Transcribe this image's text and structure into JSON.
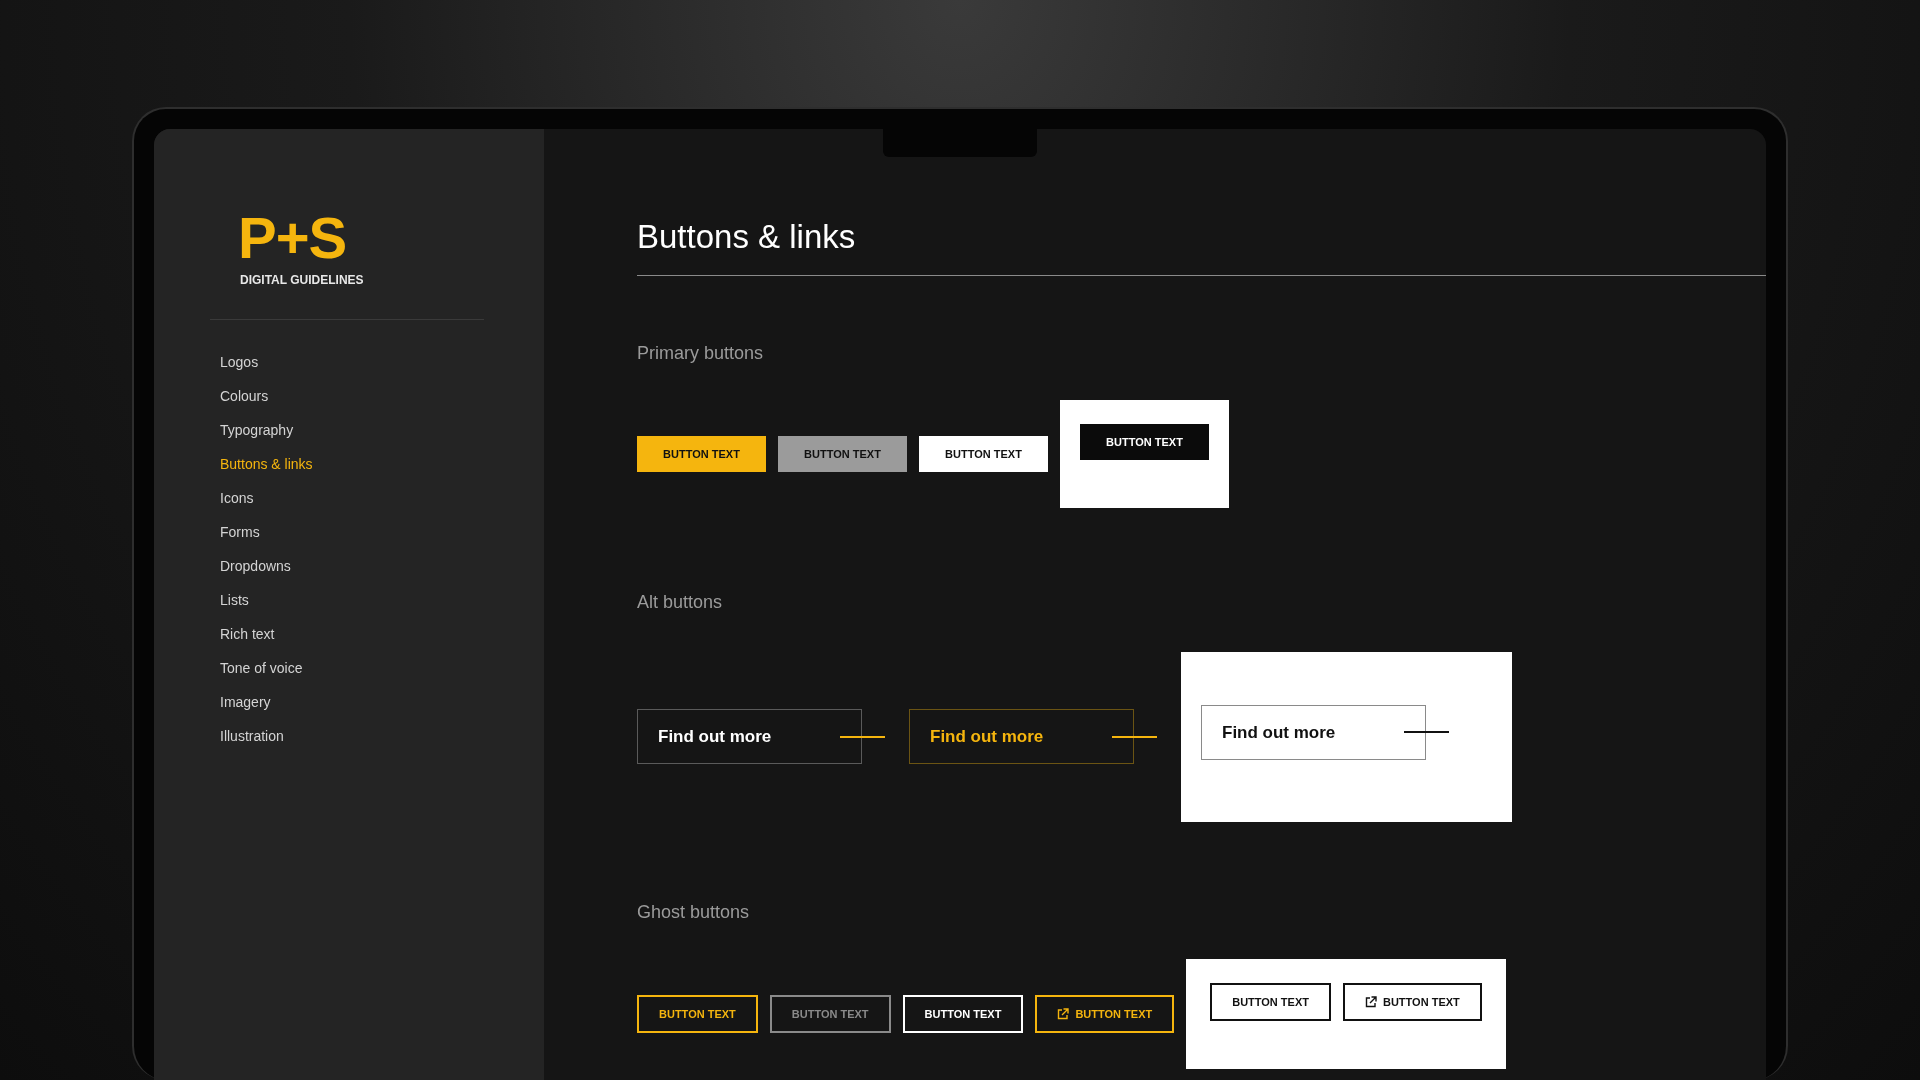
{
  "logo": {
    "mark": "P+S",
    "subtitle": "DIGITAL GUIDELINES"
  },
  "sidebar": {
    "items": [
      {
        "label": "Logos",
        "selected": false
      },
      {
        "label": "Colours",
        "selected": false
      },
      {
        "label": "Typography",
        "selected": false
      },
      {
        "label": "Buttons & links",
        "selected": true
      },
      {
        "label": "Icons",
        "selected": false
      },
      {
        "label": "Forms",
        "selected": false
      },
      {
        "label": "Dropdowns",
        "selected": false
      },
      {
        "label": "Lists",
        "selected": false
      },
      {
        "label": "Rich text",
        "selected": false
      },
      {
        "label": "Tone of voice",
        "selected": false
      },
      {
        "label": "Imagery",
        "selected": false
      },
      {
        "label": "Illustration",
        "selected": false
      }
    ]
  },
  "page_title": "Buttons & links",
  "sections": [
    {
      "title": "Primary buttons",
      "kind": "primary",
      "buttons": [
        {
          "label": "BUTTON TEXT",
          "kind": "yellow"
        },
        {
          "label": "BUTTON TEXT",
          "kind": "grey"
        },
        {
          "label": "BUTTON TEXT",
          "kind": "white"
        }
      ],
      "panel_buttons": [
        {
          "label": "BUTTON TEXT",
          "kind": "black"
        }
      ]
    },
    {
      "title": "Alt buttons",
      "kind": "alt",
      "buttons": [
        {
          "label": "Find out more",
          "kind": "white"
        },
        {
          "label": "Find out more",
          "kind": "yellow"
        }
      ],
      "panel_buttons": [
        {
          "label": "Find out more",
          "kind": "black"
        }
      ]
    },
    {
      "title": "Ghost buttons",
      "kind": "ghost",
      "buttons": [
        {
          "label": "BUTTON TEXT",
          "kind": "yellow",
          "external": false
        },
        {
          "label": "BUTTON TEXT",
          "kind": "grey",
          "external": false
        },
        {
          "label": "BUTTON TEXT",
          "kind": "white",
          "external": false
        },
        {
          "label": "BUTTON TEXT",
          "kind": "yellow",
          "external": true
        }
      ],
      "panel_buttons": [
        {
          "label": "BUTTON TEXT",
          "kind": "black",
          "external": false
        },
        {
          "label": "BUTTON TEXT",
          "kind": "black",
          "external": true
        }
      ]
    }
  ]
}
